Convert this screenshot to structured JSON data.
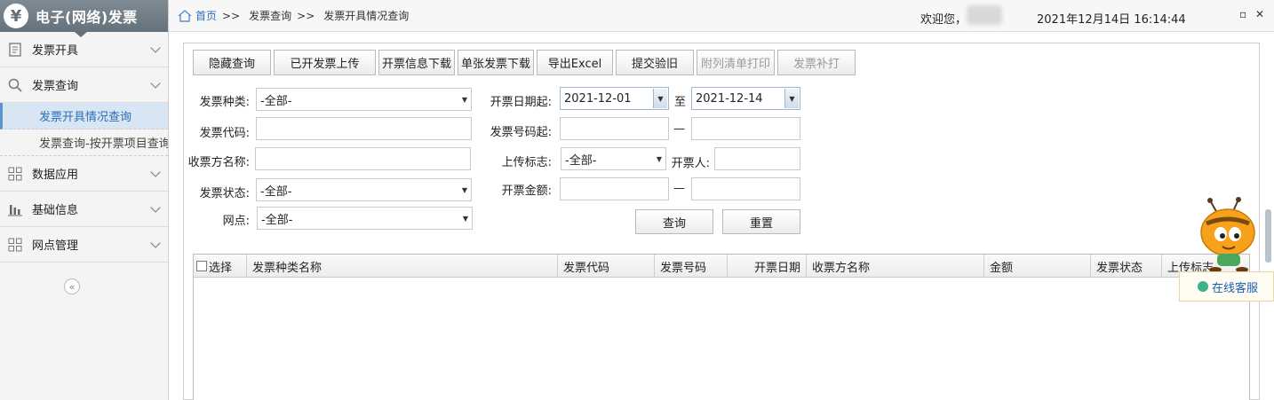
{
  "sidebar": {
    "logo_glyph": "¥",
    "title": "电子(网络)发票",
    "menu": [
      {
        "label": "发票开具",
        "icon": "document-icon"
      },
      {
        "label": "发票查询",
        "icon": "search-icon"
      },
      {
        "label": "数据应用",
        "icon": "grid-icon"
      },
      {
        "label": "基础信息",
        "icon": "bar-chart-icon"
      },
      {
        "label": "网点管理",
        "icon": "grid-icon"
      }
    ],
    "submenu": [
      {
        "label": "发票开具情况查询",
        "active": true
      },
      {
        "label": "发票查询-按开票项目查询",
        "active": false
      }
    ],
    "collapse_glyph": "«"
  },
  "topbar": {
    "breadcrumb": [
      "首页",
      "发票查询",
      "发票开具情况查询"
    ],
    "separator": ">>",
    "welcome": "欢迎您，",
    "datetime": "2021年12月14日 16:14:44",
    "restore_glyph": "▫",
    "close_glyph": "✕"
  },
  "toolbar": [
    {
      "label": "隐藏查询",
      "enabled": true
    },
    {
      "label": "已开发票上传",
      "enabled": true
    },
    {
      "label": "开票信息下载",
      "enabled": true
    },
    {
      "label": "单张发票下载",
      "enabled": true
    },
    {
      "label": "导出Excel",
      "enabled": true
    },
    {
      "label": "提交验旧",
      "enabled": true
    },
    {
      "label": "附列清单打印",
      "enabled": false
    },
    {
      "label": "发票补打",
      "enabled": false
    }
  ],
  "form": {
    "invoice_type_label": "发票种类:",
    "invoice_type_value": "-全部-",
    "invoice_code_label": "发票代码:",
    "payer_name_label": "收票方名称:",
    "invoice_status_label": "发票状态:",
    "invoice_status_value": "-全部-",
    "outlet_label": "网点:",
    "outlet_value": "-全部-",
    "date_start_label": "开票日期起:",
    "date_start_value": "2021-12-01",
    "date_to_label": "至",
    "date_end_value": "2021-12-14",
    "number_start_label": "发票号码起:",
    "range_dash": "—",
    "upload_flag_label": "上传标志:",
    "upload_flag_value": "-全部-",
    "issuer_label": "开票人:",
    "amount_label": "开票金额:",
    "query_button": "查询",
    "reset_button": "重置"
  },
  "grid": {
    "columns": [
      "选择",
      "发票种类名称",
      "发票代码",
      "发票号码",
      "开票日期",
      "收票方名称",
      "金额",
      "发票状态",
      "上传标志"
    ],
    "rows": []
  },
  "customer_service": {
    "label": "在线客服"
  }
}
